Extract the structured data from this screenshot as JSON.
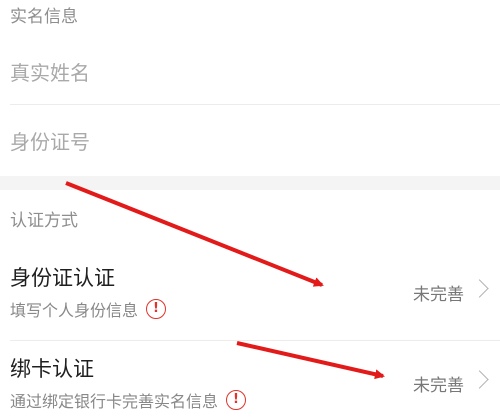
{
  "sections": {
    "realname": {
      "title": "实名信息",
      "name_placeholder": "真实姓名",
      "id_placeholder": "身份证号"
    },
    "auth": {
      "title": "认证方式",
      "items": [
        {
          "name": "身份证认证",
          "desc": "填写个人身份信息",
          "status": "未完善"
        },
        {
          "name": "绑卡认证",
          "desc": "通过绑定银行卡完善实名信息",
          "status": "未完善"
        }
      ]
    }
  },
  "icons": {
    "alert": "exclamation-circle",
    "chevron": "chevron-right"
  },
  "colors": {
    "alert": "#e0342a",
    "annotation_arrow": "#e21a1a",
    "section_gap": "#f4f4f4"
  }
}
